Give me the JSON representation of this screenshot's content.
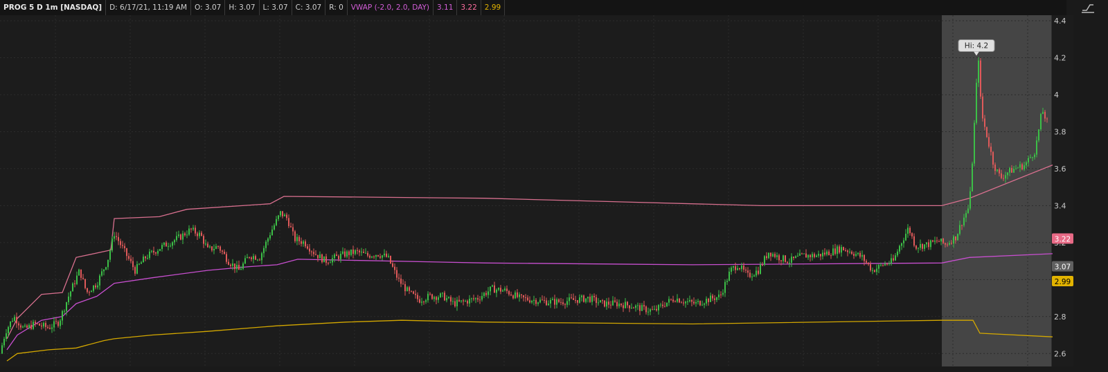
{
  "header": {
    "symbol": "PROG 5 D 1m [NASDAQ]",
    "date": "D: 6/17/21, 11:19 AM",
    "open": "O: 3.07",
    "high": "H: 3.07",
    "low": "L: 3.07",
    "close": "C: 3.07",
    "range": "R: 0",
    "vwap_label": "VWAP (-2.0, 2.0, DAY)",
    "vwap_value": "3.11",
    "upper_value": "3.22",
    "lower_value": "2.99"
  },
  "colors": {
    "bg": "#1c1c1c",
    "grid": "#2c2c2c",
    "up": "#3cbf47",
    "down": "#e05a5a",
    "vwap": "#c84fd0",
    "upper_band": "#d9708f",
    "lower_band": "#d4a800",
    "highlight": "#454545"
  },
  "chart_data": {
    "type": "candlestick",
    "y_ticks": [
      "2.6",
      "2.8",
      "3",
      "3.2",
      "3.4",
      "3.6",
      "3.8",
      "4",
      "4.2",
      "4.4"
    ],
    "ylim": [
      2.53,
      4.43
    ],
    "price_badges": [
      {
        "label": "3.22",
        "value": 3.22,
        "color": "#e86a86",
        "text_color": "#ffffff"
      },
      {
        "label": "3.07",
        "value": 3.07,
        "color": "#606060",
        "text_color": "#ffffff"
      },
      {
        "label": "2.99",
        "value": 2.99,
        "color": "#e2b300",
        "text_color": "#000000"
      }
    ],
    "annotation": {
      "label": "Hi: 4.2",
      "value": 4.2
    },
    "close_path": [
      [
        0,
        2.6
      ],
      [
        8,
        2.72
      ],
      [
        20,
        2.8
      ],
      [
        35,
        2.73
      ],
      [
        50,
        2.76
      ],
      [
        70,
        2.74
      ],
      [
        85,
        2.77
      ],
      [
        100,
        2.92
      ],
      [
        115,
        3.05
      ],
      [
        125,
        2.93
      ],
      [
        140,
        2.98
      ],
      [
        155,
        3.1
      ],
      [
        165,
        3.25
      ],
      [
        180,
        3.15
      ],
      [
        195,
        3.05
      ],
      [
        210,
        3.12
      ],
      [
        230,
        3.17
      ],
      [
        245,
        3.2
      ],
      [
        260,
        3.23
      ],
      [
        275,
        3.27
      ],
      [
        290,
        3.24
      ],
      [
        300,
        3.16
      ],
      [
        315,
        3.18
      ],
      [
        330,
        3.1
      ],
      [
        345,
        3.05
      ],
      [
        360,
        3.13
      ],
      [
        375,
        3.12
      ],
      [
        390,
        3.25
      ],
      [
        405,
        3.36
      ],
      [
        415,
        3.33
      ],
      [
        425,
        3.22
      ],
      [
        440,
        3.2
      ],
      [
        455,
        3.14
      ],
      [
        470,
        3.1
      ],
      [
        485,
        3.12
      ],
      [
        500,
        3.14
      ],
      [
        515,
        3.15
      ],
      [
        530,
        3.13
      ],
      [
        545,
        3.14
      ],
      [
        560,
        3.12
      ],
      [
        575,
        3.0
      ],
      [
        590,
        2.93
      ],
      [
        605,
        2.89
      ],
      [
        620,
        2.91
      ],
      [
        640,
        2.91
      ],
      [
        655,
        2.87
      ],
      [
        670,
        2.88
      ],
      [
        690,
        2.9
      ],
      [
        710,
        2.95
      ],
      [
        730,
        2.94
      ],
      [
        750,
        2.9
      ],
      [
        770,
        2.89
      ],
      [
        790,
        2.88
      ],
      [
        810,
        2.88
      ],
      [
        830,
        2.89
      ],
      [
        850,
        2.9
      ],
      [
        870,
        2.87
      ],
      [
        890,
        2.87
      ],
      [
        910,
        2.86
      ],
      [
        930,
        2.84
      ],
      [
        945,
        2.83
      ],
      [
        960,
        2.87
      ],
      [
        975,
        2.9
      ],
      [
        990,
        2.88
      ],
      [
        1005,
        2.87
      ],
      [
        1020,
        2.89
      ],
      [
        1040,
        2.91
      ],
      [
        1055,
        3.05
      ],
      [
        1065,
        3.08
      ],
      [
        1080,
        3.02
      ],
      [
        1095,
        3.05
      ],
      [
        1110,
        3.15
      ],
      [
        1125,
        3.12
      ],
      [
        1140,
        3.1
      ],
      [
        1160,
        3.13
      ],
      [
        1180,
        3.13
      ],
      [
        1200,
        3.15
      ],
      [
        1215,
        3.17
      ],
      [
        1230,
        3.15
      ],
      [
        1245,
        3.12
      ],
      [
        1260,
        3.05
      ],
      [
        1275,
        3.08
      ],
      [
        1290,
        3.1
      ],
      [
        1300,
        3.19
      ],
      [
        1312,
        3.28
      ],
      [
        1322,
        3.18
      ],
      [
        1340,
        3.19
      ],
      [
        1355,
        3.21
      ],
      [
        1365,
        3.19
      ],
      [
        1380,
        3.23
      ],
      [
        1390,
        3.32
      ],
      [
        1400,
        3.4
      ],
      [
        1405,
        3.7
      ],
      [
        1410,
        4.05
      ],
      [
        1413,
        4.2
      ],
      [
        1417,
        3.9
      ],
      [
        1425,
        3.78
      ],
      [
        1435,
        3.62
      ],
      [
        1445,
        3.55
      ],
      [
        1455,
        3.58
      ],
      [
        1465,
        3.6
      ],
      [
        1480,
        3.62
      ],
      [
        1495,
        3.7
      ],
      [
        1505,
        3.92
      ],
      [
        1512,
        3.85
      ]
    ],
    "vwap": [
      [
        10,
        2.62
      ],
      [
        25,
        2.7
      ],
      [
        60,
        2.78
      ],
      [
        90,
        2.8
      ],
      [
        110,
        2.87
      ],
      [
        140,
        2.91
      ],
      [
        165,
        2.98
      ],
      [
        220,
        3.01
      ],
      [
        300,
        3.05
      ],
      [
        360,
        3.07
      ],
      [
        400,
        3.08
      ],
      [
        430,
        3.11
      ],
      [
        700,
        3.09
      ],
      [
        1000,
        3.08
      ],
      [
        1360,
        3.09
      ],
      [
        1400,
        3.12
      ],
      [
        1520,
        3.14
      ]
    ],
    "upper_band": [
      [
        10,
        2.68
      ],
      [
        25,
        2.79
      ],
      [
        60,
        2.92
      ],
      [
        90,
        2.93
      ],
      [
        110,
        3.12
      ],
      [
        160,
        3.16
      ],
      [
        165,
        3.33
      ],
      [
        230,
        3.34
      ],
      [
        270,
        3.38
      ],
      [
        390,
        3.41
      ],
      [
        410,
        3.45
      ],
      [
        700,
        3.44
      ],
      [
        1100,
        3.4
      ],
      [
        1360,
        3.4
      ],
      [
        1400,
        3.44
      ],
      [
        1520,
        3.62
      ]
    ],
    "lower_band": [
      [
        10,
        2.56
      ],
      [
        25,
        2.6
      ],
      [
        70,
        2.62
      ],
      [
        110,
        2.63
      ],
      [
        150,
        2.67
      ],
      [
        165,
        2.68
      ],
      [
        220,
        2.7
      ],
      [
        300,
        2.72
      ],
      [
        400,
        2.75
      ],
      [
        500,
        2.77
      ],
      [
        580,
        2.78
      ],
      [
        700,
        2.77
      ],
      [
        1000,
        2.76
      ],
      [
        1360,
        2.78
      ],
      [
        1405,
        2.78
      ],
      [
        1415,
        2.71
      ],
      [
        1520,
        2.69
      ]
    ]
  }
}
